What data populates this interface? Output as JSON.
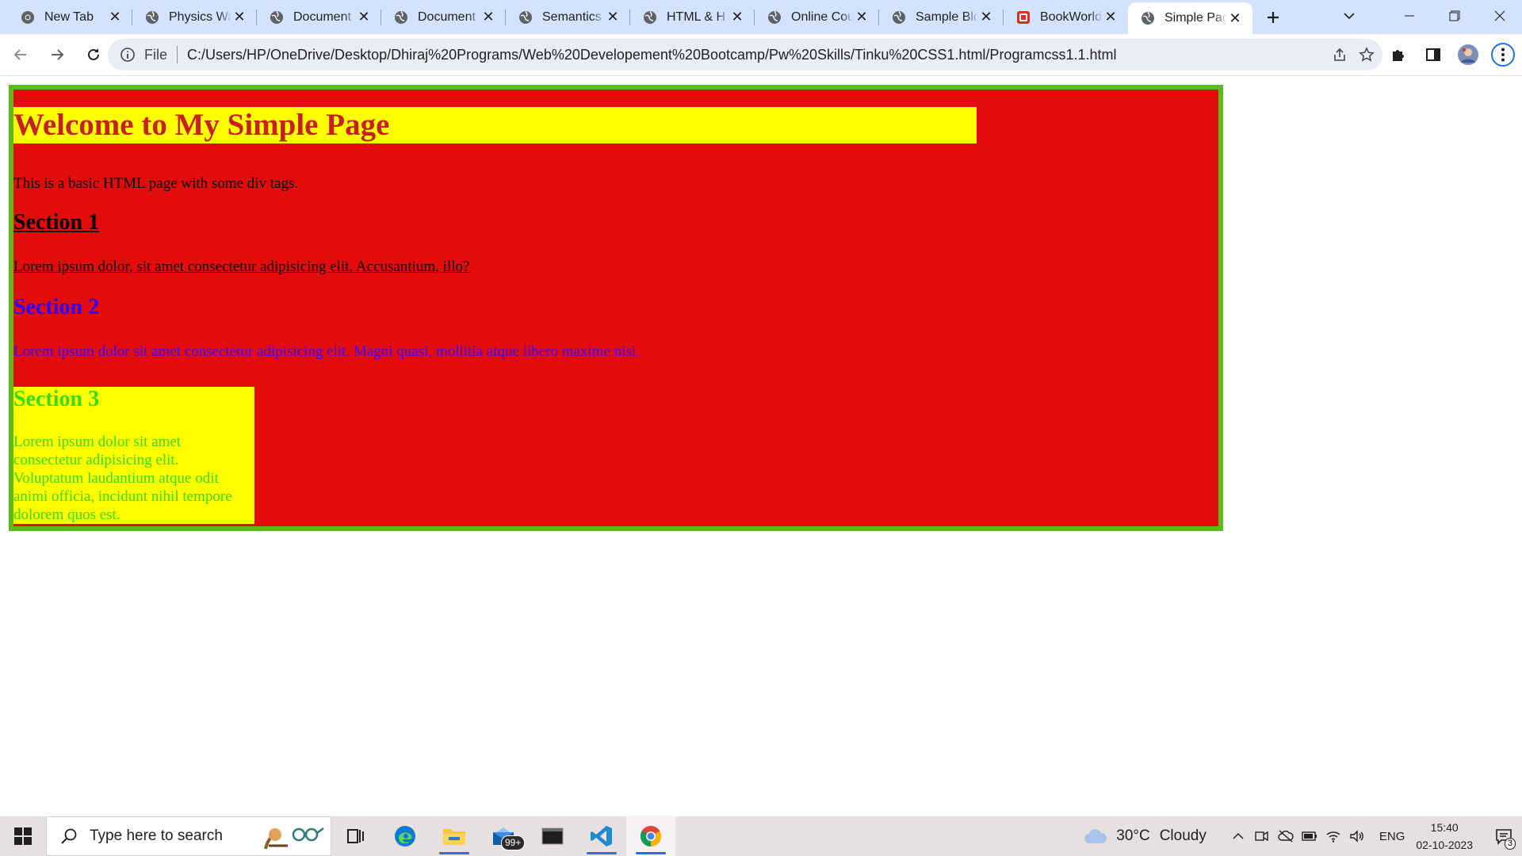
{
  "browser": {
    "tabs": [
      {
        "title": "New Tab",
        "icon": "chrome-icon",
        "active": false
      },
      {
        "title": "Physics Wa",
        "icon": "globe-icon",
        "active": false
      },
      {
        "title": "Document",
        "icon": "globe-icon",
        "active": false
      },
      {
        "title": "Document",
        "icon": "globe-icon",
        "active": false
      },
      {
        "title": "Semantics",
        "icon": "globe-icon",
        "active": false
      },
      {
        "title": "HTML & H",
        "icon": "globe-icon",
        "active": false
      },
      {
        "title": "Online Cou",
        "icon": "globe-icon",
        "active": false
      },
      {
        "title": "Sample Blo",
        "icon": "globe-icon",
        "active": false
      },
      {
        "title": "BookWorld",
        "icon": "bookworld-icon",
        "active": false
      },
      {
        "title": "Simple Pag",
        "icon": "globe-icon",
        "active": true
      }
    ],
    "address": {
      "scheme_label": "File",
      "url": "C:/Users/HP/OneDrive/Desktop/Dhiraj%20Programs/Web%20Developement%20Bootcamp/Pw%20Skills/Tinku%20CSS1.html/Programcss1.1.html"
    }
  },
  "page": {
    "title": "Welcome to My Simple Page",
    "intro": "This is a basic HTML page with some div tags.",
    "sections": [
      {
        "heading": "Section 1",
        "text": "Lorem ipsum dolor, sit amet consectetur adipisicing elit. Accusantium, illo?"
      },
      {
        "heading": "Section 2",
        "text": "Lorem ipsum dolor sit amet consectetur adipisicing elit. Magni quasi, mollitia atque libero maxime nisi."
      },
      {
        "heading": "Section 3",
        "text": "Lorem ipsum dolor sit amet consectetur adipisicing elit. Voluptatum laudantium atque odit animi officia, incidunt nihil tempore dolorem quos est."
      }
    ],
    "colors": {
      "outer_border": "#5bbd14",
      "outer_background": "#e30c0c",
      "title_background": "#ffff00",
      "title_text": "#c62020",
      "section2_text": "#2a00ff",
      "section3_text": "#33dd11"
    }
  },
  "taskbar": {
    "search_placeholder": "Type here to search",
    "mail_badge": "99+",
    "weather_temp": "30°C",
    "weather_condition": "Cloudy",
    "language": "ENG",
    "time": "15:40",
    "date": "02-10-2023",
    "notification_count": "3"
  }
}
